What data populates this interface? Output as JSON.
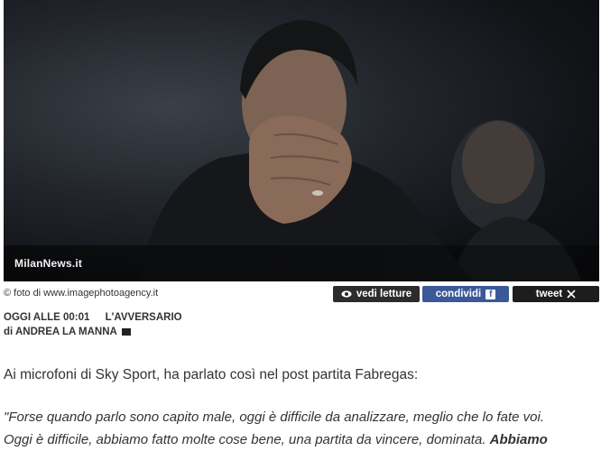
{
  "photo": {
    "watermark": "MilanNews.it",
    "alt": "Fabregas"
  },
  "credit": "© foto di www.imagephotoagency.it",
  "buttons": {
    "letture": {
      "label": "vedi letture",
      "icon": "eye-icon"
    },
    "condividi": {
      "label": "condividi",
      "icon": "facebook-icon"
    },
    "tweet": {
      "label": "tweet",
      "icon": "x-icon"
    }
  },
  "meta": {
    "date": "OGGI ALLE 00:01",
    "category": "L'AVVERSARIO",
    "author": "di ANDREA LA MANNA",
    "author_icon": "flag-icon"
  },
  "article": {
    "intro": "Ai microfoni di Sky Sport, ha parlato così nel post partita Fabregas:",
    "quote_line1": "\"Forse quando parlo sono capito male, oggi è difficile da analizzare, meglio che lo fate voi.",
    "quote_line2": "Oggi è difficile, abbiamo fatto molte cose bene, una partita da vincere, dominata. ",
    "quote_line2_bold": "Abbiamo"
  },
  "colors": {
    "facebook": "#3b5998",
    "dark_button": "#2c2c2c"
  }
}
